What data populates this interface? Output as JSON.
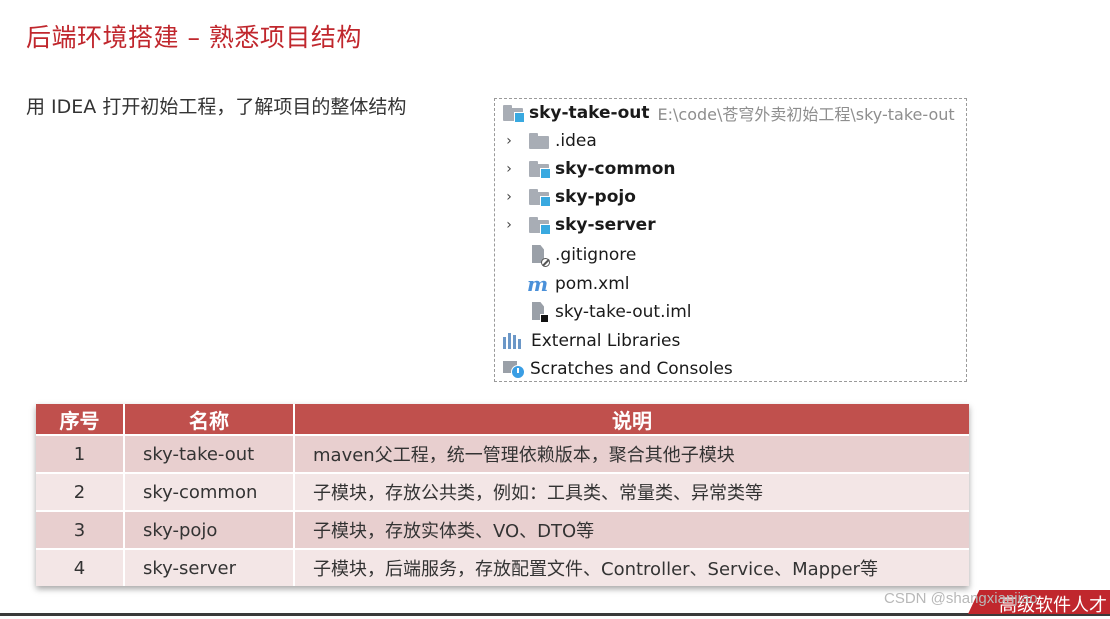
{
  "page": {
    "title": "后端环境搭建 – 熟悉项目结构",
    "intro": "用 IDEA 打开初始工程，了解项目的整体结构"
  },
  "tree": {
    "root_name": "sky-take-out",
    "root_path": "E:\\code\\苍穹外卖初始工程\\sky-take-out",
    "items": [
      {
        "label": "sky-take-out",
        "icon": "module-folder-icon"
      },
      {
        "label": ".idea",
        "icon": "folder-icon"
      },
      {
        "label": "sky-common",
        "icon": "module-folder-icon"
      },
      {
        "label": "sky-pojo",
        "icon": "module-folder-icon"
      },
      {
        "label": "sky-server",
        "icon": "module-folder-icon"
      },
      {
        "label": ".gitignore",
        "icon": "ignored-file-icon"
      },
      {
        "label": "pom.xml",
        "icon": "maven-icon"
      },
      {
        "label": "sky-take-out.iml",
        "icon": "iml-file-icon"
      },
      {
        "label": "External Libraries",
        "icon": "libraries-icon"
      },
      {
        "label": "Scratches and Consoles",
        "icon": "scratches-icon"
      }
    ]
  },
  "table": {
    "headers": [
      "序号",
      "名称",
      "说明"
    ],
    "rows": [
      [
        "1",
        "sky-take-out",
        "maven父工程，统一管理依赖版本，聚合其他子模块"
      ],
      [
        "2",
        "sky-common",
        "子模块，存放公共类，例如：工具类、常量类、异常类等"
      ],
      [
        "3",
        "sky-pojo",
        "子模块，存放实体类、VO、DTO等"
      ],
      [
        "4",
        "sky-server",
        "子模块，后端服务，存放配置文件、Controller、Service、Mapper等"
      ]
    ]
  },
  "footer": {
    "watermark": "CSDN @shangxianjiao",
    "brand": "高级软件人才"
  },
  "colors": {
    "title": "#c0272d",
    "table_header": "#c0504d",
    "row_odd": "#e8cfcf",
    "row_even": "#f3e6e6"
  }
}
